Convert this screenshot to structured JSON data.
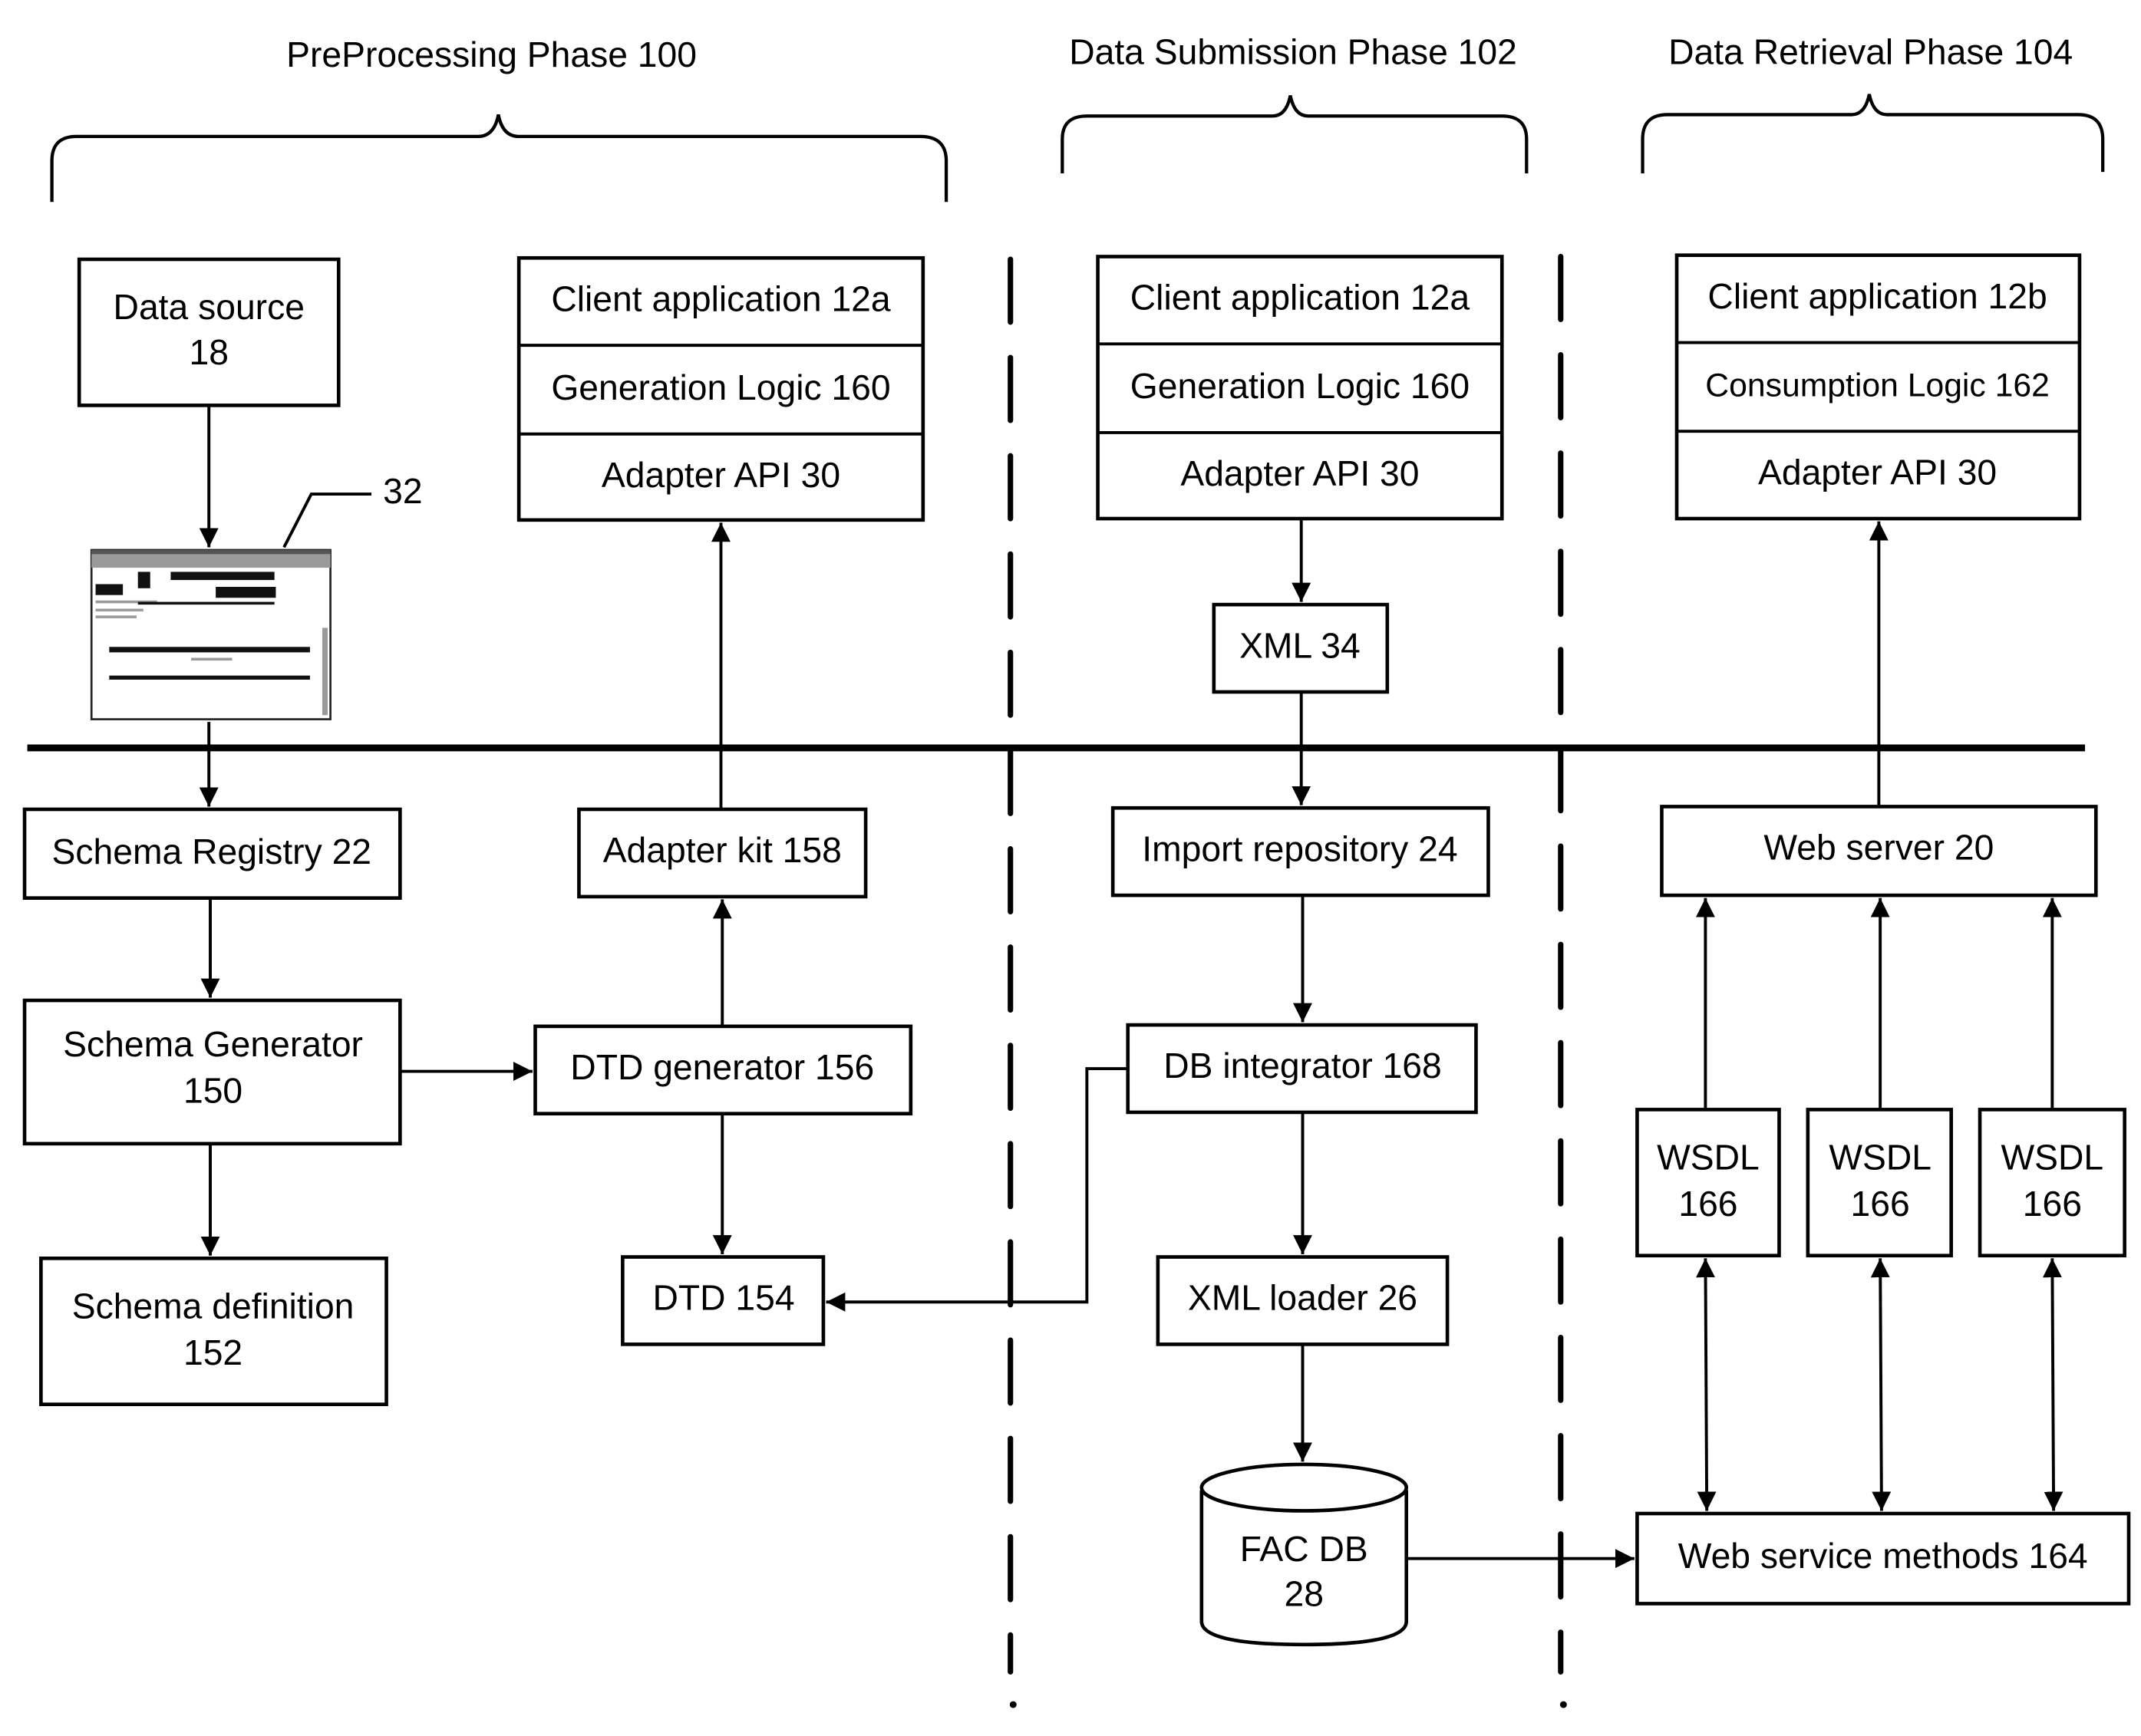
{
  "phases": {
    "preprocessing": "PreProcessing Phase 100",
    "submission": "Data Submission Phase 102",
    "retrieval": "Data Retrieval Phase 104"
  },
  "preprocessing": {
    "data_source": [
      "Data source",
      "18"
    ],
    "screenshot_ref": "32",
    "client_stack": {
      "client": "Client application 12a",
      "logic": "Generation Logic 160",
      "api": "Adapter API 30"
    },
    "schema_registry": "Schema Registry 22",
    "adapter_kit": "Adapter kit 158",
    "schema_generator": [
      "Schema Generator",
      "150"
    ],
    "dtd_generator": "DTD generator 156",
    "schema_definition": [
      "Schema definition",
      "152"
    ],
    "dtd": "DTD 154"
  },
  "submission": {
    "client_stack": {
      "client": "Client application 12a",
      "logic": "Generation Logic 160",
      "api": "Adapter API 30"
    },
    "xml": "XML 34",
    "import_repository": "Import repository 24",
    "db_integrator": "DB integrator 168",
    "xml_loader": "XML loader 26",
    "fac_db": [
      "FAC DB",
      "28"
    ]
  },
  "retrieval": {
    "client_stack": {
      "client": "Client application 12b",
      "logic": "Consumption Logic 162",
      "api": "Adapter API 30"
    },
    "web_server": "Web server 20",
    "wsdl": [
      [
        "WSDL",
        "166"
      ],
      [
        "WSDL",
        "166"
      ],
      [
        "WSDL",
        "166"
      ]
    ],
    "web_service_methods": "Web service methods 164"
  }
}
